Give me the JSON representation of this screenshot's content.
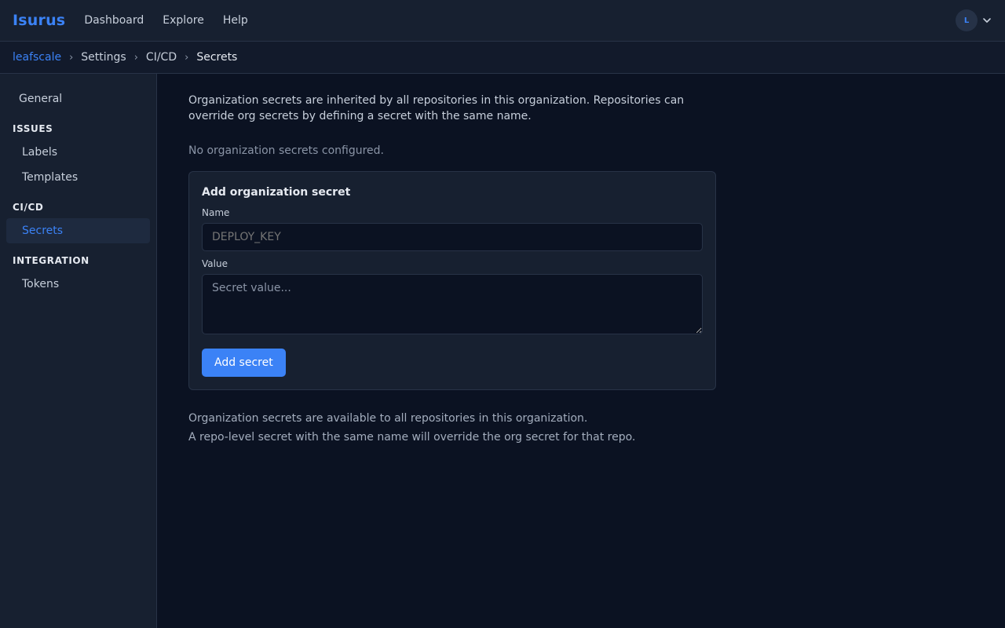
{
  "app": {
    "name": "Isurus"
  },
  "topnav": {
    "items": [
      "Dashboard",
      "Explore",
      "Help"
    ]
  },
  "user": {
    "initial": "L",
    "menu_icon": "chevron-down-icon"
  },
  "breadcrumb": {
    "org": "leafscale",
    "items": [
      "Settings",
      "CI/CD",
      "Secrets"
    ],
    "separator": "›"
  },
  "sidebar": {
    "general": "General",
    "sections": [
      {
        "heading": "ISSUES",
        "items": [
          "Labels",
          "Templates"
        ]
      },
      {
        "heading": "CI/CD",
        "items": [
          "Secrets"
        ]
      },
      {
        "heading": "INTEGRATION",
        "items": [
          "Tokens"
        ]
      }
    ],
    "active": "Secrets"
  },
  "main": {
    "intro": "Organization secrets are inherited by all repositories in this organization. Repositories can override org secrets by defining a secret with the same name.",
    "empty_state": "No organization secrets configured.",
    "form": {
      "title": "Add organization secret",
      "name_label": "Name",
      "name_placeholder": "DEPLOY_KEY",
      "value_label": "Value",
      "value_placeholder": "Secret value...",
      "submit_label": "Add secret"
    },
    "notes": [
      "Organization secrets are available to all repositories in this organization.",
      "A repo-level secret with the same name will override the org secret for that repo."
    ]
  },
  "colors": {
    "accent": "#3b82f6",
    "background": "#0b1222",
    "surface": "#172030"
  }
}
